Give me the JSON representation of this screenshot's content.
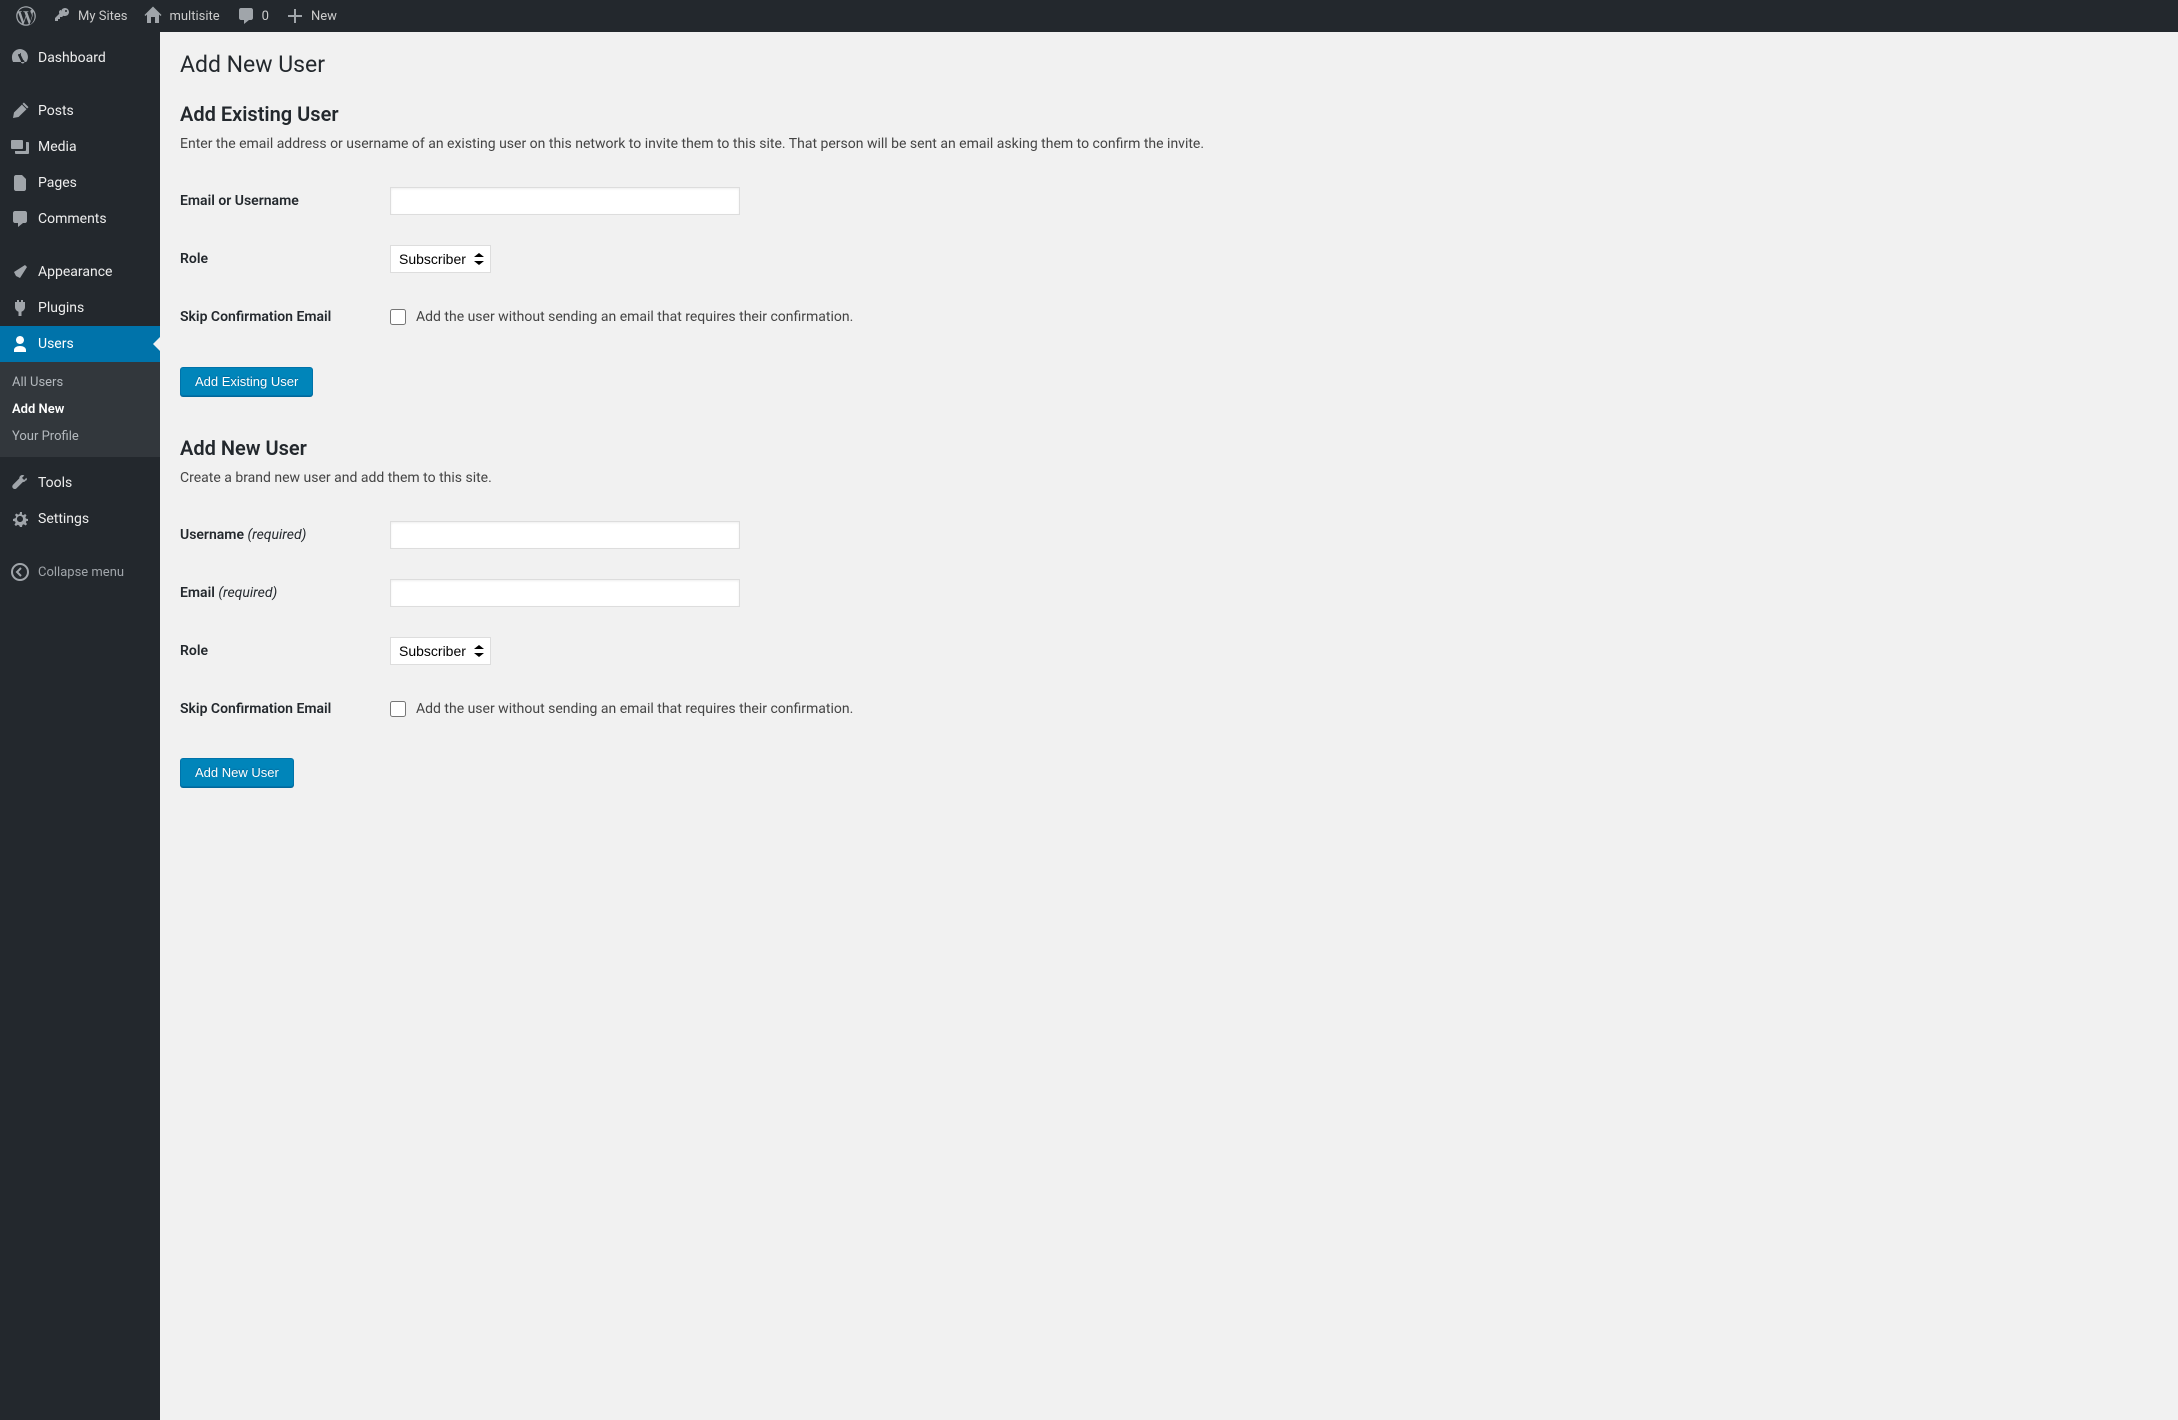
{
  "adminbar": {
    "my_sites": "My Sites",
    "site_name": "multisite",
    "comments_count": "0",
    "new_label": "New"
  },
  "sidebar": {
    "items": [
      {
        "label": "Dashboard"
      },
      {
        "label": "Posts"
      },
      {
        "label": "Media"
      },
      {
        "label": "Pages"
      },
      {
        "label": "Comments"
      },
      {
        "label": "Appearance"
      },
      {
        "label": "Plugins"
      },
      {
        "label": "Users"
      },
      {
        "label": "Tools"
      },
      {
        "label": "Settings"
      }
    ],
    "users_sub": [
      {
        "label": "All Users"
      },
      {
        "label": "Add New"
      },
      {
        "label": "Your Profile"
      }
    ],
    "collapse_label": "Collapse menu"
  },
  "page": {
    "title": "Add New User",
    "existing": {
      "heading": "Add Existing User",
      "desc": "Enter the email address or username of an existing user on this network to invite them to this site. That person will be sent an email asking them to confirm the invite.",
      "email_label": "Email or Username",
      "role_label": "Role",
      "role_value": "Subscriber",
      "skip_label": "Skip Confirmation Email",
      "skip_desc": "Add the user without sending an email that requires their confirmation.",
      "submit": "Add Existing User"
    },
    "new": {
      "heading": "Add New User",
      "desc": "Create a brand new user and add them to this site.",
      "username_label": "Username",
      "username_req": "(required)",
      "email_label": "Email",
      "email_req": "(required)",
      "role_label": "Role",
      "role_value": "Subscriber",
      "skip_label": "Skip Confirmation Email",
      "skip_desc": "Add the user without sending an email that requires their confirmation.",
      "submit": "Add New User"
    }
  }
}
